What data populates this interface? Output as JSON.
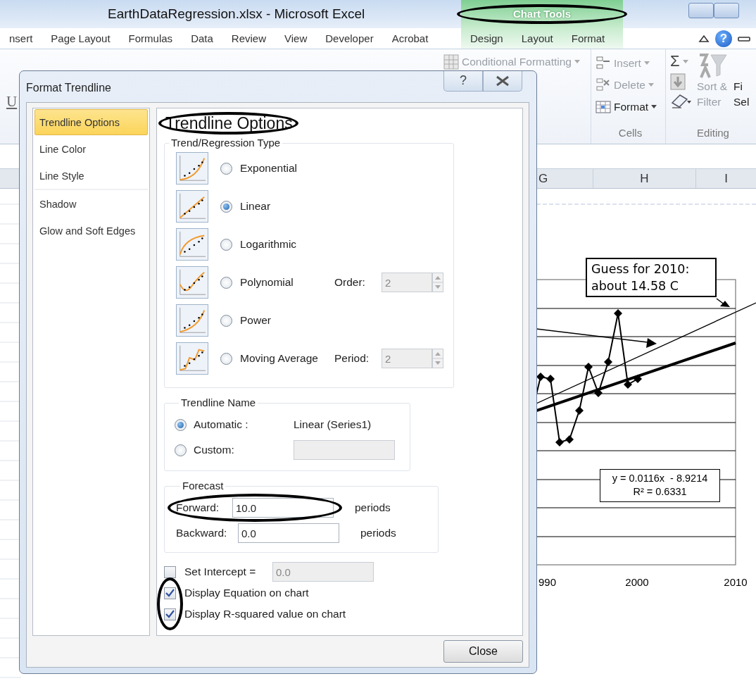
{
  "window": {
    "title": "EarthDataRegression.xlsx - Microsoft Excel",
    "context_tab": {
      "label": "Chart Tools",
      "circled": true,
      "tabs": [
        "Design",
        "Layout",
        "Format"
      ]
    }
  },
  "ribbon_tabs": [
    "nsert",
    "Page Layout",
    "Formulas",
    "Data",
    "Review",
    "View",
    "Developer",
    "Acrobat"
  ],
  "ribbon": {
    "help": "?",
    "underline": "U",
    "conditional_formatting": {
      "label": "Conditional Formatting",
      "disabled": true
    },
    "cells": {
      "label": "Cells",
      "buttons": [
        {
          "label": "Insert",
          "disabled": true
        },
        {
          "label": "Delete",
          "disabled": true
        },
        {
          "label": "Format",
          "disabled": false
        }
      ]
    },
    "editing": {
      "label": "Editing",
      "sum": "Σ",
      "sort": {
        "lines": [
          "Sort &",
          "Filter"
        ],
        "disabled": true
      },
      "find": {
        "lines": [
          "Fi",
          "Sel"
        ],
        "disabled": false
      }
    }
  },
  "sheet": {
    "columns": [
      "G",
      "H",
      "I"
    ]
  },
  "chart": {
    "callout": "Guess for 2010: about 14.58 C",
    "equation": "y = 0.0116x  - 8.9214",
    "r_squared": "R² = 0.6331",
    "x_labels": [
      "990",
      "2000",
      "2010"
    ]
  },
  "dialog": {
    "title": "Format Trendline",
    "help": "?",
    "nav_groups": [
      {
        "items": [
          {
            "label": "Trendline Options",
            "selected": true
          },
          {
            "label": "Line Color",
            "selected": false
          },
          {
            "label": "Line Style",
            "selected": false
          }
        ]
      },
      {
        "items": [
          {
            "label": "Shadow",
            "selected": false
          },
          {
            "label": "Glow and Soft Edges",
            "selected": false
          }
        ]
      }
    ],
    "heading": {
      "text": "Trendline Options",
      "circled": true
    },
    "regression": {
      "legend": "Trend/Regression Type",
      "types": [
        {
          "kind": "exponential",
          "label": "Exponential",
          "selected": false
        },
        {
          "kind": "linear",
          "label": "Linear",
          "selected": true
        },
        {
          "kind": "logarithmic",
          "label": "Logarithmic",
          "selected": false
        },
        {
          "kind": "polynomial",
          "label": "Polynomial",
          "selected": false,
          "param": {
            "label": "Order:",
            "value": "2",
            "disabled": true
          }
        },
        {
          "kind": "power",
          "label": "Power",
          "selected": false
        },
        {
          "kind": "moving",
          "label": "Moving Average",
          "selected": false,
          "param": {
            "label": "Period:",
            "value": "2",
            "disabled": true
          }
        }
      ]
    },
    "name": {
      "legend": "Trendline Name",
      "options": [
        {
          "label": "Automatic :",
          "selected": true,
          "value": "Linear (Series1)"
        },
        {
          "label": "Custom:",
          "selected": false,
          "disabled": true
        }
      ]
    },
    "forecast": {
      "legend": "Forecast",
      "rows": [
        {
          "label": "Forward:",
          "value": "10.0",
          "unit": "periods",
          "circled": true
        },
        {
          "label": "Backward:",
          "value": "0.0",
          "unit": "periods",
          "circled": false
        }
      ]
    },
    "intercept": {
      "label": "Set Intercept =",
      "checked": false,
      "value": "0.0",
      "disabled": true
    },
    "display": {
      "circled": true,
      "items": [
        {
          "label": "Display Equation on chart",
          "checked": true
        },
        {
          "label": "Display R-squared value on chart",
          "checked": true
        }
      ]
    },
    "close": "Close"
  }
}
